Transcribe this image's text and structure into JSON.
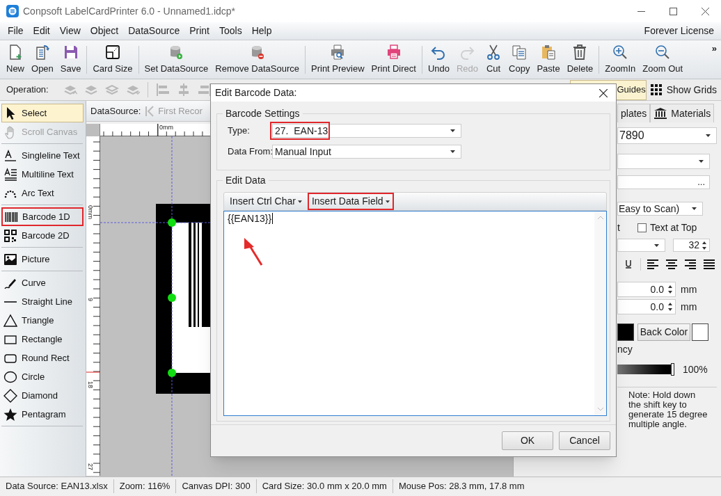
{
  "window": {
    "title": "Conpsoft LabelCardPrinter 6.0 - Unnamed1.idcp*"
  },
  "menu": {
    "items": [
      "File",
      "Edit",
      "View",
      "Object",
      "DataSource",
      "Print",
      "Tools",
      "Help"
    ],
    "license": "Forever License"
  },
  "toolbar": {
    "groups": [
      [
        {
          "label": "New",
          "disabled": false
        },
        {
          "label": "Open",
          "disabled": false
        },
        {
          "label": "Save",
          "disabled": false
        }
      ],
      [
        {
          "label": "Card Size",
          "disabled": false
        }
      ],
      [
        {
          "label": "Set DataSource",
          "disabled": false
        },
        {
          "label": "Remove DataSource",
          "disabled": false
        }
      ],
      [
        {
          "label": "Print Preview",
          "disabled": false
        },
        {
          "label": "Print Direct",
          "disabled": false
        }
      ],
      [
        {
          "label": "Undo",
          "disabled": false
        },
        {
          "label": "Redo",
          "disabled": true
        },
        {
          "label": "Cut",
          "disabled": false
        },
        {
          "label": "Copy",
          "disabled": false
        },
        {
          "label": "Paste",
          "disabled": false
        },
        {
          "label": "Delete",
          "disabled": false
        }
      ],
      [
        {
          "label": "ZoomIn",
          "disabled": false
        },
        {
          "label": "Zoom Out",
          "disabled": false
        }
      ]
    ],
    "overflow": "»"
  },
  "operation_bar": {
    "label": "Operation:",
    "tools": [
      {
        "disabled": true
      },
      {
        "disabled": true
      },
      {
        "disabled": true
      },
      {
        "disabled": true
      },
      {
        "disabled": true
      },
      {
        "disabled": true
      },
      {
        "disabled": true
      }
    ],
    "toggles": [
      {
        "label": "Guides",
        "selected": true
      },
      {
        "label": "Show Grids",
        "selected": false
      }
    ]
  },
  "tool_panel": {
    "groups": [
      [
        {
          "label": "Select",
          "selected": true,
          "disabled": false,
          "annotated": false
        },
        {
          "label": "Scroll Canvas",
          "selected": false,
          "disabled": true,
          "annotated": false
        }
      ],
      [
        {
          "label": "Singleline Text",
          "selected": false,
          "disabled": false,
          "annotated": false
        },
        {
          "label": "Multiline Text",
          "selected": false,
          "disabled": false,
          "annotated": false
        },
        {
          "label": "Arc Text",
          "selected": false,
          "disabled": false,
          "annotated": false
        }
      ],
      [
        {
          "label": "Barcode 1D",
          "selected": false,
          "disabled": false,
          "annotated": true
        },
        {
          "label": "Barcode 2D",
          "selected": false,
          "disabled": false,
          "annotated": false
        }
      ],
      [
        {
          "label": "Picture",
          "selected": false,
          "disabled": false,
          "annotated": false
        }
      ],
      [
        {
          "label": "Curve",
          "selected": false,
          "disabled": false,
          "annotated": false
        },
        {
          "label": "Straight Line",
          "selected": false,
          "disabled": false,
          "annotated": false
        },
        {
          "label": "Triangle",
          "selected": false,
          "disabled": false,
          "annotated": false
        },
        {
          "label": "Rectangle",
          "selected": false,
          "disabled": false,
          "annotated": false
        },
        {
          "label": "Round Rect",
          "selected": false,
          "disabled": false,
          "annotated": false
        },
        {
          "label": "Circle",
          "selected": false,
          "disabled": false,
          "annotated": false
        },
        {
          "label": "Diamond",
          "selected": false,
          "disabled": false,
          "annotated": false
        },
        {
          "label": "Pentagram",
          "selected": false,
          "disabled": false,
          "annotated": false
        }
      ]
    ]
  },
  "canvas": {
    "datasource_label": "DataSource:",
    "first_record": "First Recor",
    "horizontal_ruler": [
      "0mm"
    ],
    "vertical_ruler": [
      "0mm",
      "9",
      "18",
      "27"
    ]
  },
  "properties_panel": {
    "tabs": [
      {
        "label": "plates",
        "selected": false
      },
      {
        "label": "Materials",
        "selected": false
      }
    ],
    "barcode_value": "7890",
    "more_button": "...",
    "readability": "Easy to Scan)",
    "text_option_label": "t",
    "text_at_top": {
      "label": "Text at Top",
      "checked": false
    },
    "font_size": "32",
    "offsets": [
      {
        "value": "0.0",
        "unit": "mm"
      },
      {
        "value": "0.0",
        "unit": "mm"
      }
    ],
    "swatches": [
      {
        "kind": "fore",
        "color": "#000000"
      },
      {
        "kind": "back",
        "color": "#ffffff"
      }
    ],
    "back_color_button": "Back Color",
    "transparency_label": "ncy",
    "opacity": {
      "level": 1,
      "reading": "100%"
    },
    "note": "Note: Hold down the shift key to generate 15 degree multiple angle."
  },
  "dialog": {
    "title": "Edit Barcode Data:",
    "settings": {
      "legend": "Barcode Settings",
      "fields": [
        {
          "label": "Type:",
          "value": "27.  EAN-13",
          "annotated": true
        },
        {
          "label": "Data From:",
          "value": "Manual Input",
          "annotated": false
        }
      ]
    },
    "edit": {
      "legend": "Edit Data",
      "buttons": [
        {
          "label": "Insert Ctrl Char",
          "annotated": false
        },
        {
          "label": "Insert Data Field",
          "annotated": true
        }
      ],
      "content": "{{EAN13}}"
    },
    "buttons": [
      "OK",
      "Cancel"
    ]
  },
  "status_bar": [
    "Data Source: EAN13.xlsx",
    "Zoom: 116%",
    "Canvas DPI: 300",
    "Card Size: 30.0 mm x 20.0 mm",
    "Mouse Pos: 28.3 mm, 17.8 mm"
  ]
}
